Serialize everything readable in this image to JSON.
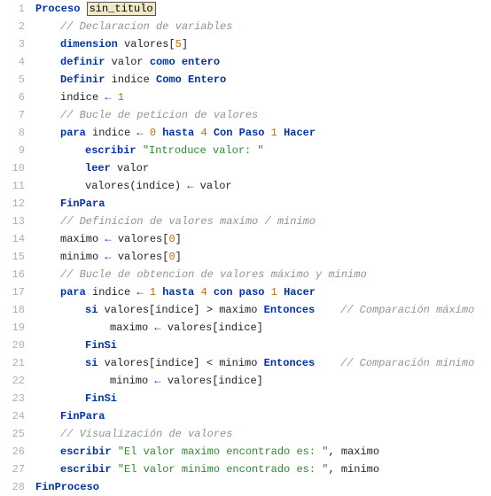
{
  "lines": [
    {
      "n": 1,
      "indent": "i1",
      "parts": [
        [
          "kw",
          "Proceso "
        ],
        [
          "boxed",
          "sin_titulo"
        ]
      ]
    },
    {
      "n": 2,
      "indent": "i2",
      "parts": [
        [
          "cmt",
          "// Declaracion de variables"
        ]
      ]
    },
    {
      "n": 3,
      "indent": "i2",
      "parts": [
        [
          "kw",
          "dimension"
        ],
        [
          "var",
          " valores["
        ],
        [
          "num",
          "5"
        ],
        [
          "var",
          "]"
        ]
      ]
    },
    {
      "n": 4,
      "indent": "i2",
      "parts": [
        [
          "kw",
          "definir"
        ],
        [
          "var",
          " valor "
        ],
        [
          "kw",
          "como entero"
        ]
      ]
    },
    {
      "n": 5,
      "indent": "i2",
      "parts": [
        [
          "kw",
          "Definir"
        ],
        [
          "var",
          " indice "
        ],
        [
          "kw",
          "Como Entero"
        ]
      ]
    },
    {
      "n": 6,
      "indent": "i2",
      "parts": [
        [
          "var",
          "indice "
        ],
        [
          "kw",
          "←"
        ],
        [
          "var",
          " "
        ],
        [
          "num",
          "1"
        ]
      ]
    },
    {
      "n": 7,
      "indent": "i2",
      "parts": [
        [
          "cmt",
          "// Bucle de peticion de valores"
        ]
      ]
    },
    {
      "n": 8,
      "indent": "i2",
      "parts": [
        [
          "kw",
          "para"
        ],
        [
          "var",
          " indice "
        ],
        [
          "kw",
          "←"
        ],
        [
          "var",
          " "
        ],
        [
          "num",
          "0"
        ],
        [
          "var",
          " "
        ],
        [
          "kw",
          "hasta"
        ],
        [
          "var",
          " "
        ],
        [
          "num",
          "4"
        ],
        [
          "var",
          " "
        ],
        [
          "kw",
          "Con Paso"
        ],
        [
          "var",
          " "
        ],
        [
          "num",
          "1"
        ],
        [
          "var",
          " "
        ],
        [
          "kw",
          "Hacer"
        ]
      ]
    },
    {
      "n": 9,
      "indent": "i3",
      "parts": [
        [
          "kw",
          "escribir"
        ],
        [
          "var",
          " "
        ],
        [
          "str",
          "\"Introduce valor: \""
        ]
      ]
    },
    {
      "n": 10,
      "indent": "i3",
      "parts": [
        [
          "kw",
          "leer"
        ],
        [
          "var",
          " valor"
        ]
      ]
    },
    {
      "n": 11,
      "indent": "i3",
      "parts": [
        [
          "var",
          "valores(indice) "
        ],
        [
          "kw",
          "←"
        ],
        [
          "var",
          " valor"
        ]
      ]
    },
    {
      "n": 12,
      "indent": "i2",
      "parts": [
        [
          "kw",
          "FinPara"
        ]
      ]
    },
    {
      "n": 13,
      "indent": "i2",
      "parts": [
        [
          "cmt",
          "// Definicion de valores maximo / minimo"
        ]
      ]
    },
    {
      "n": 14,
      "indent": "i2",
      "parts": [
        [
          "var",
          "maximo "
        ],
        [
          "kw",
          "←"
        ],
        [
          "var",
          " valores["
        ],
        [
          "num",
          "0"
        ],
        [
          "var",
          "]"
        ]
      ]
    },
    {
      "n": 15,
      "indent": "i2",
      "parts": [
        [
          "var",
          "minimo "
        ],
        [
          "kw",
          "←"
        ],
        [
          "var",
          " valores["
        ],
        [
          "num",
          "0"
        ],
        [
          "var",
          "]"
        ]
      ]
    },
    {
      "n": 16,
      "indent": "i2",
      "parts": [
        [
          "cmt",
          "// Bucle de obtencion de valores máximo y minimo"
        ]
      ]
    },
    {
      "n": 17,
      "indent": "i2",
      "parts": [
        [
          "kw",
          "para"
        ],
        [
          "var",
          " indice "
        ],
        [
          "kw",
          "←"
        ],
        [
          "var",
          " "
        ],
        [
          "num",
          "1"
        ],
        [
          "var",
          " "
        ],
        [
          "kw",
          "hasta"
        ],
        [
          "var",
          " "
        ],
        [
          "num",
          "4"
        ],
        [
          "var",
          " "
        ],
        [
          "kw",
          "con paso"
        ],
        [
          "var",
          " "
        ],
        [
          "num",
          "1"
        ],
        [
          "var",
          " "
        ],
        [
          "kw",
          "Hacer"
        ]
      ]
    },
    {
      "n": 18,
      "indent": "i3",
      "parts": [
        [
          "kw",
          "si"
        ],
        [
          "var",
          " valores[indice] > maximo "
        ],
        [
          "kw",
          "Entonces"
        ],
        [
          "var",
          "    "
        ],
        [
          "trailcmt",
          "// Comparación máximo"
        ]
      ]
    },
    {
      "n": 19,
      "indent": "i4",
      "parts": [
        [
          "var",
          "maximo "
        ],
        [
          "kw",
          "←"
        ],
        [
          "var",
          " valores[indice]"
        ]
      ]
    },
    {
      "n": 20,
      "indent": "i3",
      "parts": [
        [
          "kw",
          "FinSi"
        ]
      ]
    },
    {
      "n": 21,
      "indent": "i3",
      "parts": [
        [
          "kw",
          "si"
        ],
        [
          "var",
          " valores[indice] < minimo "
        ],
        [
          "kw",
          "Entonces"
        ],
        [
          "var",
          "    "
        ],
        [
          "trailcmt",
          "// Comparación minimo"
        ]
      ]
    },
    {
      "n": 22,
      "indent": "i4",
      "parts": [
        [
          "var",
          "minimo "
        ],
        [
          "kw",
          "←"
        ],
        [
          "var",
          " valores[indice]"
        ]
      ]
    },
    {
      "n": 23,
      "indent": "i3",
      "parts": [
        [
          "kw",
          "FinSi"
        ]
      ]
    },
    {
      "n": 24,
      "indent": "i2",
      "parts": [
        [
          "kw",
          "FinPara"
        ]
      ]
    },
    {
      "n": 25,
      "indent": "i2",
      "parts": [
        [
          "cmt",
          "// Visualización de valores"
        ]
      ]
    },
    {
      "n": 26,
      "indent": "i2",
      "parts": [
        [
          "kw",
          "escribir"
        ],
        [
          "var",
          " "
        ],
        [
          "str",
          "\"El valor maximo encontrado es: \""
        ],
        [
          "var",
          ", maximo"
        ]
      ]
    },
    {
      "n": 27,
      "indent": "i2",
      "parts": [
        [
          "kw",
          "escribir"
        ],
        [
          "var",
          " "
        ],
        [
          "str",
          "\"El valor minimo encontrado es: \""
        ],
        [
          "var",
          ", minimo"
        ]
      ]
    },
    {
      "n": 28,
      "indent": "i1",
      "parts": [
        [
          "kw",
          "FinProceso"
        ]
      ]
    }
  ]
}
